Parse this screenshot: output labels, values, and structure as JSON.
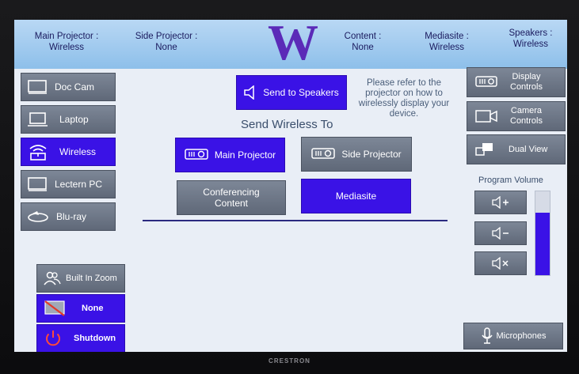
{
  "header": {
    "main_projector": {
      "label": "Main Projector :",
      "value": "Wireless"
    },
    "side_projector": {
      "label": "Side Projector :",
      "value": "None"
    },
    "logo_letter": "W",
    "content": {
      "label": "Content :",
      "value": "None"
    },
    "mediasite": {
      "label": "Mediasite :",
      "value": "Wireless"
    },
    "speakers": {
      "label": "Speakers :",
      "value": "Wireless"
    }
  },
  "sources": [
    {
      "label": "Doc Cam",
      "icon": "monitor-icon",
      "active": false
    },
    {
      "label": "Laptop",
      "icon": "laptop-icon",
      "active": false
    },
    {
      "label": "Wireless",
      "icon": "wireless-icon",
      "active": true
    },
    {
      "label": "Lectern PC",
      "icon": "monitor-icon",
      "active": false
    },
    {
      "label": "Blu-ray",
      "icon": "bluray-icon",
      "active": false
    }
  ],
  "left_bottom": {
    "zoom": "Built In Zoom",
    "none": "None",
    "shutdown": "Shutdown"
  },
  "center": {
    "send_to_speakers": "Send to Speakers",
    "hint": [
      "Please refer to the",
      "projector on how to",
      "wirelessly display your",
      "device."
    ],
    "title": "Send Wireless To",
    "main_projector": "Main Projector",
    "side_projector": "Side Projector",
    "conferencing": [
      "Conferencing",
      "Content"
    ],
    "mediasite": "Mediasite"
  },
  "right": {
    "display_controls": [
      "Display",
      "Controls"
    ],
    "camera_controls": [
      "Camera",
      "Controls"
    ],
    "dual_view": "Dual View",
    "program_volume": "Program Volume",
    "volume_level": 0.75,
    "microphones": "Microphones"
  },
  "brand": "CRESTRON",
  "colors": {
    "active_blue": "#3a12e6",
    "header": "#a6cdf0",
    "logo_purple": "#5b2ab8"
  }
}
